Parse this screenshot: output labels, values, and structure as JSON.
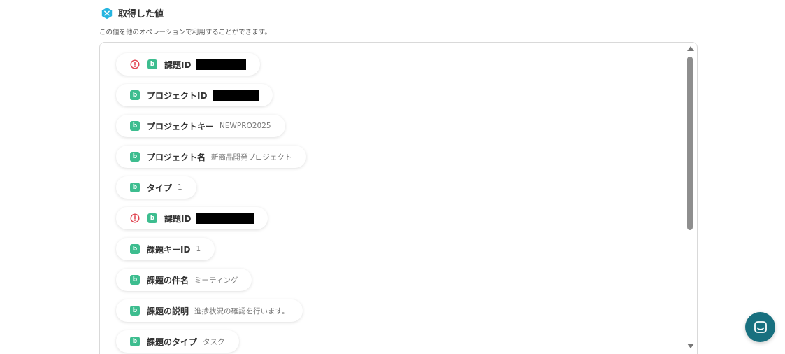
{
  "header": {
    "title": "取得した値",
    "subtitle": "この値を他のオペレーションで利用することができます。"
  },
  "fields": [
    {
      "label": "課題ID",
      "value": "",
      "warning": true,
      "redacted": true
    },
    {
      "label": "プロジェクトID",
      "value": "",
      "warning": false,
      "redacted": true
    },
    {
      "label": "プロジェクトキー",
      "value": "NEWPRO2025",
      "warning": false,
      "redacted": false
    },
    {
      "label": "プロジェクト名",
      "value": "新商品開発プロジェクト",
      "warning": false,
      "redacted": false
    },
    {
      "label": "タイプ",
      "value": "1",
      "warning": false,
      "redacted": false
    },
    {
      "label": "課題ID",
      "value": "",
      "warning": true,
      "redacted": true
    },
    {
      "label": "課題キーID",
      "value": "1",
      "warning": false,
      "redacted": false
    },
    {
      "label": "課題の件名",
      "value": "ミーティング",
      "warning": false,
      "redacted": false
    },
    {
      "label": "課題の説明",
      "value": "進捗状況の確認を行います。",
      "warning": false,
      "redacted": false
    },
    {
      "label": "課題のタイプ",
      "value": "タスク",
      "warning": false,
      "redacted": false
    }
  ],
  "service_icon_letter": "b",
  "icons": {
    "header": "yoom-hex-icon",
    "service": "backlog-icon",
    "warning": "warning-circle-icon",
    "chat": "chat-icon"
  },
  "colors": {
    "accent": "#26b5e0",
    "service_green": "#3dbd8f",
    "warning_red": "#e0424f",
    "chat_button": "#18707f"
  }
}
